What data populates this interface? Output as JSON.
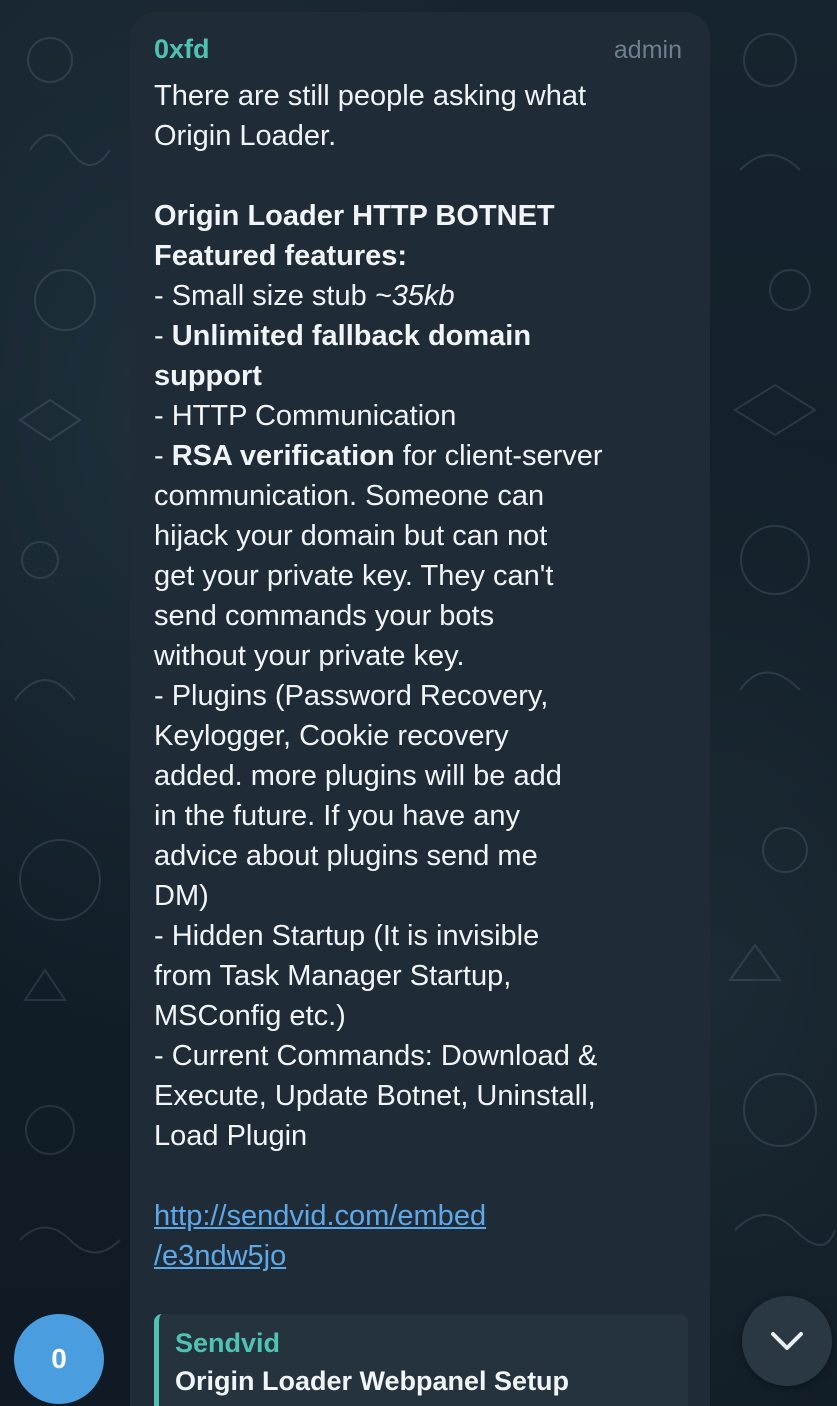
{
  "message": {
    "sender": "0xfd",
    "role": "admin",
    "lines": [
      {
        "segments": [
          {
            "text": "There are still people asking what"
          }
        ]
      },
      {
        "segments": [
          {
            "text": "Origin Loader."
          }
        ]
      },
      {
        "blank": true
      },
      {
        "segments": [
          {
            "text": "Origin Loader HTTP BOTNET",
            "bold": true
          }
        ]
      },
      {
        "segments": [
          {
            "text": "Featured features:",
            "bold": true
          }
        ]
      },
      {
        "segments": [
          {
            "text": "- Small size stub "
          },
          {
            "text": "~35kb",
            "italic": true
          }
        ]
      },
      {
        "segments": [
          {
            "text": "- "
          },
          {
            "text": "Unlimited fallback domain",
            "bold": true
          }
        ]
      },
      {
        "segments": [
          {
            "text": "support",
            "bold": true
          }
        ]
      },
      {
        "segments": [
          {
            "text": "- HTTP Communication"
          }
        ]
      },
      {
        "segments": [
          {
            "text": "- "
          },
          {
            "text": "RSA verification",
            "bold": true
          },
          {
            "text": " for client-server"
          }
        ]
      },
      {
        "segments": [
          {
            "text": "communication. Someone can"
          }
        ]
      },
      {
        "segments": [
          {
            "text": "hijack your domain but can not"
          }
        ]
      },
      {
        "segments": [
          {
            "text": "get your private key. They can't"
          }
        ]
      },
      {
        "segments": [
          {
            "text": "send commands your bots"
          }
        ]
      },
      {
        "segments": [
          {
            "text": "without your private key."
          }
        ]
      },
      {
        "segments": [
          {
            "text": "- Plugins (Password Recovery,"
          }
        ]
      },
      {
        "segments": [
          {
            "text": "Keylogger, Cookie recovery"
          }
        ]
      },
      {
        "segments": [
          {
            "text": "added. more plugins will be add"
          }
        ]
      },
      {
        "segments": [
          {
            "text": "in the future. If you have any"
          }
        ]
      },
      {
        "segments": [
          {
            "text": "advice about plugins send me"
          }
        ]
      },
      {
        "segments": [
          {
            "text": "DM)"
          }
        ]
      },
      {
        "segments": [
          {
            "text": "- Hidden Startup (It is invisible"
          }
        ]
      },
      {
        "segments": [
          {
            "text": "from Task Manager Startup,"
          }
        ]
      },
      {
        "segments": [
          {
            "text": "MSConfig etc.)"
          }
        ]
      },
      {
        "segments": [
          {
            "text": "- Current Commands: Download &"
          }
        ]
      },
      {
        "segments": [
          {
            "text": "Execute, Update Botnet, Uninstall,"
          }
        ]
      },
      {
        "segments": [
          {
            "text": "Load Plugin"
          }
        ]
      },
      {
        "blank": true
      }
    ],
    "link_lines": [
      "http://sendvid.com/embed",
      "/e3ndw5jo"
    ],
    "preview": {
      "site": "Sendvid",
      "title": "Origin Loader Webpanel Setup"
    }
  },
  "avatar": {
    "label": "0",
    "color": "#4a9ee0"
  },
  "scroll_button": {
    "icon": "chevron-down-icon"
  },
  "colors": {
    "bubble": "#1f2c38",
    "sender": "#4fc3b1",
    "link": "#5fa8e8",
    "text": "#f2f5f7"
  }
}
